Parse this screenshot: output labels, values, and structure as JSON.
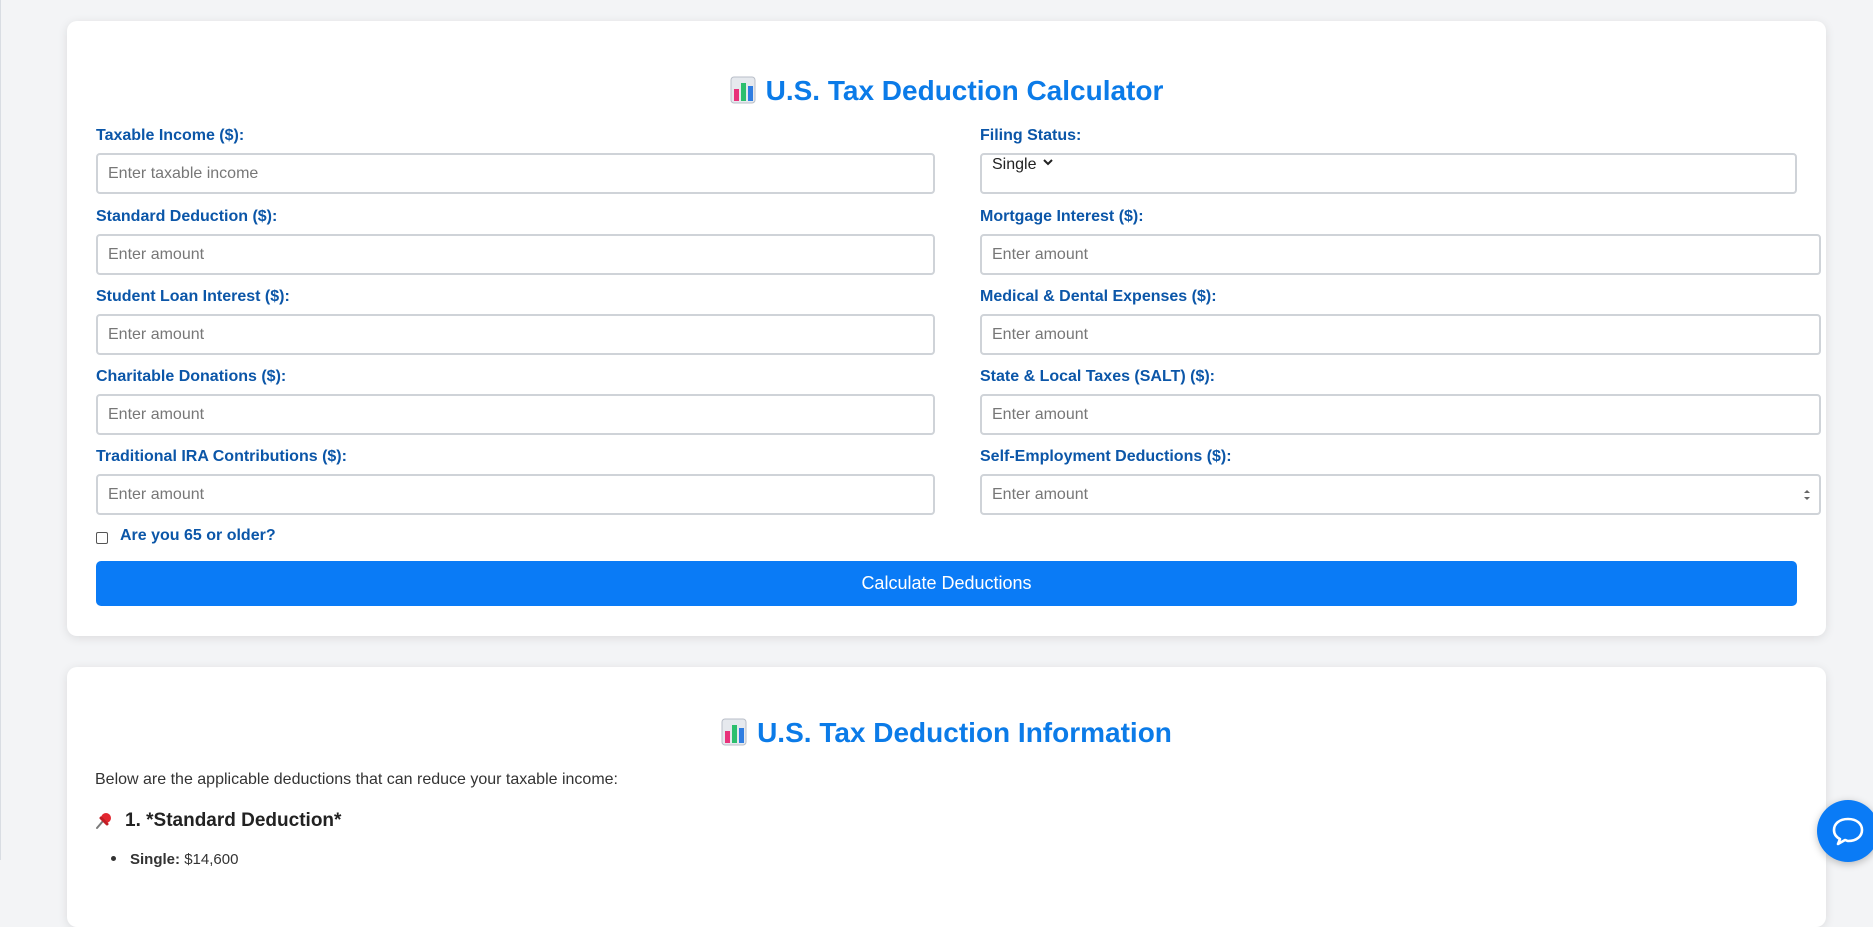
{
  "calculator": {
    "title": "U.S. Tax Deduction Calculator",
    "fields": {
      "taxable_income": {
        "label": "Taxable Income ($):",
        "placeholder": "Enter taxable income",
        "value": ""
      },
      "filing_status": {
        "label": "Filing Status:",
        "value": "Single"
      },
      "standard_deduction": {
        "label": "Standard Deduction ($):",
        "placeholder": "Enter amount",
        "value": ""
      },
      "mortgage_interest": {
        "label": "Mortgage Interest ($):",
        "placeholder": "Enter amount",
        "value": ""
      },
      "student_loan_interest": {
        "label": "Student Loan Interest ($):",
        "placeholder": "Enter amount",
        "value": ""
      },
      "medical_dental": {
        "label": "Medical & Dental Expenses ($):",
        "placeholder": "Enter amount",
        "value": ""
      },
      "charitable_donations": {
        "label": "Charitable Donations ($):",
        "placeholder": "Enter amount",
        "value": ""
      },
      "salt": {
        "label": "State & Local Taxes (SALT) ($):",
        "placeholder": "Enter amount",
        "value": ""
      },
      "traditional_ira": {
        "label": "Traditional IRA Contributions ($):",
        "placeholder": "Enter amount",
        "value": ""
      },
      "self_employment": {
        "label": "Self-Employment Deductions ($):",
        "placeholder": "Enter amount",
        "value": ""
      }
    },
    "age_checkbox": {
      "label": "Are you 65 or older?",
      "checked": false
    },
    "calculate_button": "Calculate Deductions"
  },
  "info": {
    "title": "U.S. Tax Deduction Information",
    "intro": "Below are the applicable deductions that can reduce your taxable income:",
    "section_1_heading": "1. *Standard Deduction*",
    "section_1_items": [
      {
        "label": "Single:",
        "value": "$14,600"
      }
    ]
  },
  "icons": {
    "title_icon": "bar-chart-icon",
    "section_icon": "pushpin-icon",
    "chat_icon": "chat-bubble-icon"
  },
  "colors": {
    "accent": "#0a7bf6",
    "title": "#0b7be8",
    "label": "#0b56a8",
    "background": "#f3f4f6"
  }
}
